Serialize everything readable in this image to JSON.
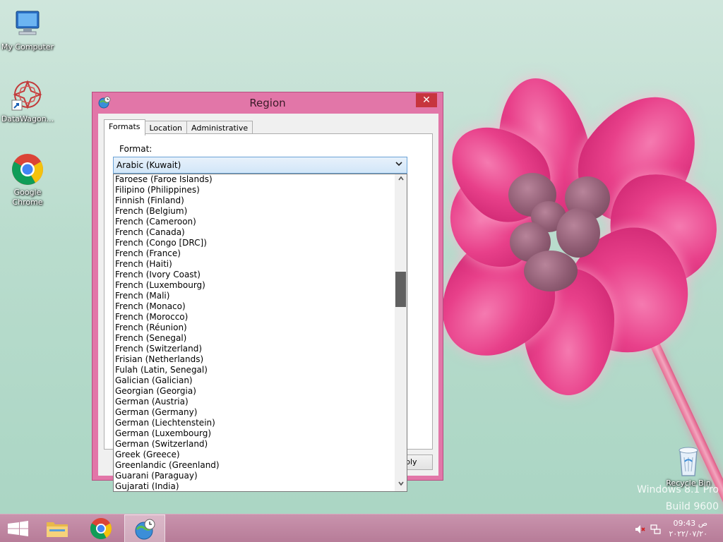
{
  "desktop": {
    "icons": [
      {
        "label": "My Computer"
      },
      {
        "label": "DataWagon..."
      },
      {
        "label": "Google Chrome"
      },
      {
        "label": "Recycle Bin"
      }
    ],
    "watermark": {
      "line1": "Windows 8.1 Pro",
      "line2": "Build 9600"
    }
  },
  "dialog": {
    "title": "Region",
    "close_label": "✕",
    "tabs": [
      {
        "label": "Formats",
        "active": true
      },
      {
        "label": "Location",
        "active": false
      },
      {
        "label": "Administrative",
        "active": false
      }
    ],
    "format_label": "Format:",
    "apply_label": "Apply",
    "format_combo": {
      "selected": "Arabic (Kuwait)"
    },
    "dropdown_items": [
      "Faroese (Faroe Islands)",
      "Filipino (Philippines)",
      "Finnish (Finland)",
      "French (Belgium)",
      "French (Cameroon)",
      "French (Canada)",
      "French (Congo [DRC])",
      "French (France)",
      "French (Haiti)",
      "French (Ivory Coast)",
      "French (Luxembourg)",
      "French (Mali)",
      "French (Monaco)",
      "French (Morocco)",
      "French (Réunion)",
      "French (Senegal)",
      "French (Switzerland)",
      "Frisian (Netherlands)",
      "Fulah (Latin, Senegal)",
      "Galician (Galician)",
      "Georgian (Georgia)",
      "German (Austria)",
      "German (Germany)",
      "German (Liechtenstein)",
      "German (Luxembourg)",
      "German (Switzerland)",
      "Greek (Greece)",
      "Greenlandic (Greenland)",
      "Guarani (Paraguay)",
      "Gujarati (India)"
    ]
  },
  "taskbar": {
    "pinned": [
      {
        "name": "start-button",
        "icon": "windows-logo-icon"
      },
      {
        "name": "file-explorer-button",
        "icon": "folder-icon"
      },
      {
        "name": "chrome-button",
        "icon": "chrome-icon"
      },
      {
        "name": "region-app-button",
        "icon": "globe-clock-icon"
      }
    ],
    "clock": {
      "time": "09:43 ص",
      "date": "٢٠٢٢/٠٧/٢٠"
    }
  },
  "colors": {
    "dialog_frame": "#e276a8",
    "close_button": "#c7343e",
    "taskbar": "#b77c98",
    "scroll_thumb": "#606060"
  }
}
